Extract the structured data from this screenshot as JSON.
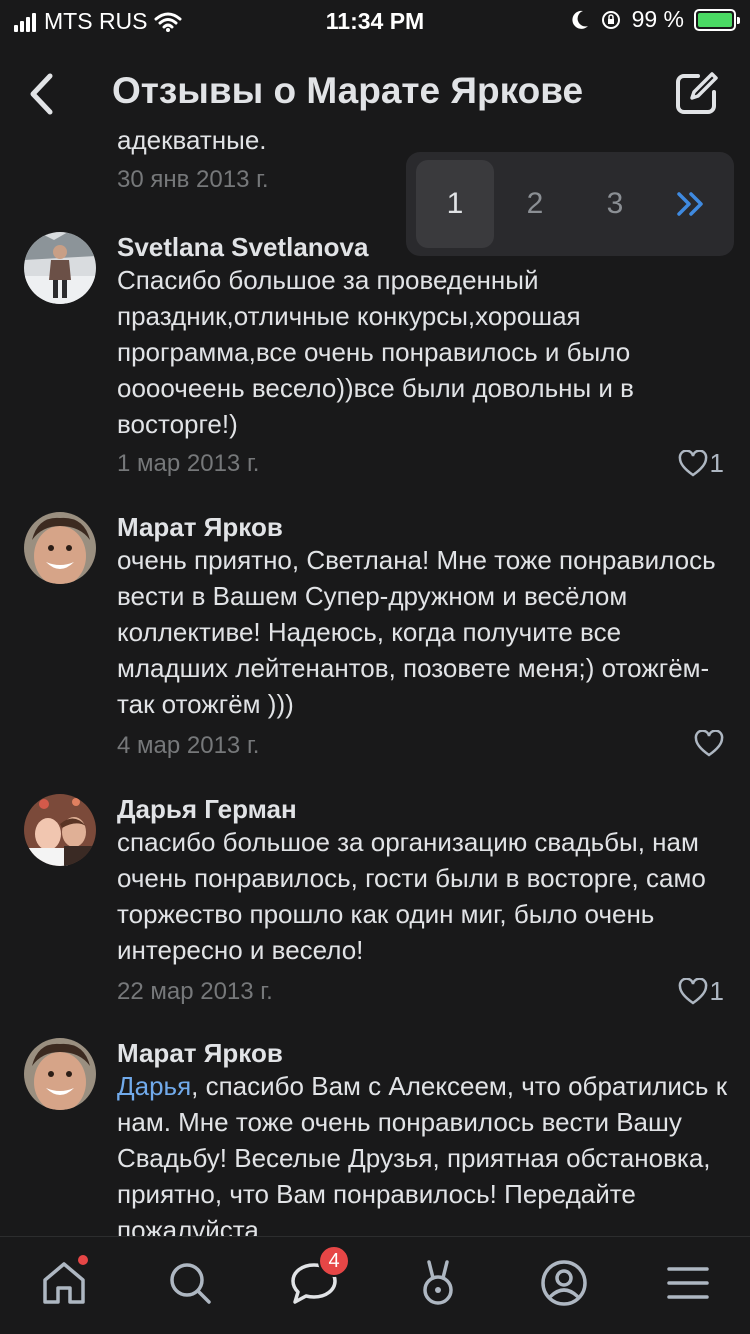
{
  "status_bar": {
    "carrier": "MTS RUS",
    "time": "11:34 PM",
    "battery": "99 %"
  },
  "header": {
    "title": "Отзывы о Марате Яркове"
  },
  "fragment": {
    "text": "адекватные.",
    "date": "30 янв 2013 г."
  },
  "pagination": {
    "pages": [
      "1",
      "2",
      "3"
    ],
    "active": "1"
  },
  "reviews": [
    {
      "author": "Svetlana Svetlanova",
      "text": "Спасибо большое за проведенный праздник,отличные конкурсы,хорошая программа,все очень понравилось и было оооочеень весело))все были довольны и в восторге!)",
      "date": "1 мар 2013 г.",
      "likes": "1"
    },
    {
      "author": "Марат Ярков",
      "text": "очень приятно, Светлана! Мне тоже понравилось вести в Вашем Супер-дружном и весёлом коллективе! Надеюсь, когда получите все младших лейтенантов, позовете меня;) отожгём- так отожгём )))",
      "date": "4 мар 2013 г.",
      "likes": ""
    },
    {
      "author": "Дарья Герман",
      "text": "спасибо большое за организацию свадьбы, нам очень понравилось, гости были в восторге, само торжество прошло как один миг, было очень интересно и весело!",
      "date": "22 мар 2013 г.",
      "likes": "1"
    },
    {
      "author": "Марат Ярков",
      "mention": "Дарья",
      "text": ", спасибо Вам с Алексеем, что обратились к нам. Мне тоже очень понравилось вести Вашу Свадьбу! Веселые Друзья, приятная обстановка, приятно, что Вам понравилось! Передайте пожалуйста"
    }
  ],
  "tabbar": {
    "messages_badge": "4"
  },
  "colors": {
    "background": "#19191a",
    "accent": "#71aaeb",
    "badge": "#e64646",
    "secondary_text": "#76787a"
  }
}
